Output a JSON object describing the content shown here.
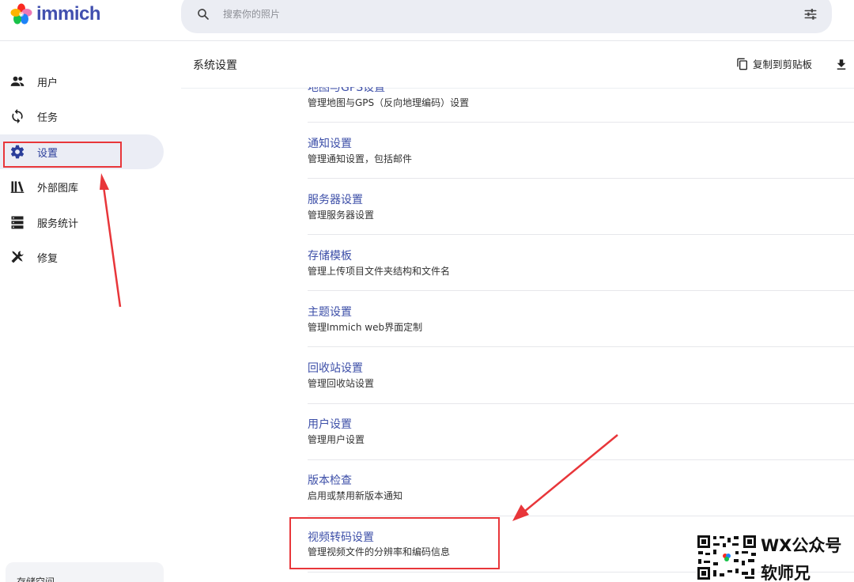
{
  "app": {
    "name": "immich"
  },
  "search": {
    "placeholder": "搜索你的照片"
  },
  "sidebar": {
    "items": [
      {
        "label": "用户",
        "icon": "users-icon"
      },
      {
        "label": "任务",
        "icon": "sync-icon"
      },
      {
        "label": "设置",
        "icon": "gear-icon",
        "active": true
      },
      {
        "label": "外部图库",
        "icon": "library-icon"
      },
      {
        "label": "服务统计",
        "icon": "server-icon"
      },
      {
        "label": "修复",
        "icon": "tools-icon"
      }
    ],
    "storage_label": "存储空间"
  },
  "main": {
    "title": "系统设置",
    "copy_label": "复制到剪贴板",
    "settings": [
      {
        "title": "地图与GPS设置",
        "desc": "管理地图与GPS（反向地理编码）设置"
      },
      {
        "title": "通知设置",
        "desc": "管理通知设置，包括邮件"
      },
      {
        "title": "服务器设置",
        "desc": "管理服务器设置"
      },
      {
        "title": "存储模板",
        "desc": "管理上传项目文件夹结构和文件名"
      },
      {
        "title": "主题设置",
        "desc": "管理Immich web界面定制"
      },
      {
        "title": "回收站设置",
        "desc": "管理回收站设置"
      },
      {
        "title": "用户设置",
        "desc": "管理用户设置"
      },
      {
        "title": "版本检查",
        "desc": "启用或禁用新版本通知"
      },
      {
        "title": "视频转码设置",
        "desc": "管理视频文件的分辨率和编码信息"
      }
    ]
  },
  "watermark": {
    "line1": "WX公众号",
    "line2": "软师兄"
  },
  "colors": {
    "accent": "#4250af",
    "annotation": "#e8363a",
    "active_bg": "#ebedf5"
  }
}
